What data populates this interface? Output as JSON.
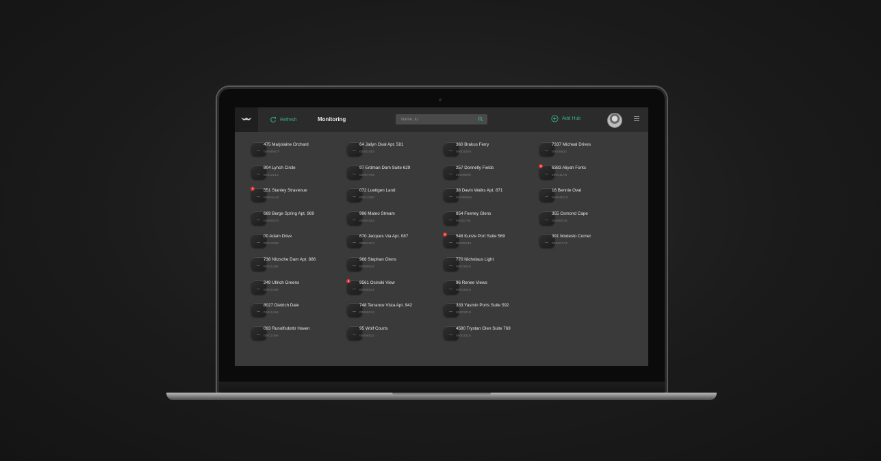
{
  "app": {
    "title": "Monitoring",
    "refresh_label": "Refresh",
    "add_hub_label": "Add Hub",
    "accent_color": "#39b08d",
    "alert_color": "#e03131"
  },
  "search": {
    "placeholder": "Name, ID"
  },
  "columns": [
    [
      {
        "name": "475 Marjolaine Orchard",
        "id": "0000B9CF",
        "alert": null
      },
      {
        "name": "804 Lynch Circle",
        "id": "00012212",
        "alert": null
      },
      {
        "name": "551 Stanley Stravenue",
        "id": "00004A42",
        "alert": "5"
      },
      {
        "name": "669 Berge Spring Apt. 969",
        "id": "00009473",
        "alert": null
      },
      {
        "name": "00 Adam Drive",
        "id": "00013339",
        "alert": null
      },
      {
        "name": "738 Nitzsche Dam Apt. 886",
        "id": "00011496",
        "alert": null
      },
      {
        "name": "249 Ullrich Greens",
        "id": "00011496",
        "alert": null
      },
      {
        "name": "8027 Dietrich Dale",
        "id": "00011496",
        "alert": null
      },
      {
        "name": "093 Runolfsdottir Haven",
        "id": "00011496",
        "alert": null
      }
    ],
    [
      {
        "name": "64 Jailyn Oval Apt. 581",
        "id": "00001083",
        "alert": null
      },
      {
        "name": "97 Erdman Dam Suite 629",
        "id": "00007006",
        "alert": null
      },
      {
        "name": "072 Luettgen Land",
        "id": "00012680",
        "alert": null
      },
      {
        "name": "996 Mateo Stream",
        "id": "00001052",
        "alert": null
      },
      {
        "name": "670 Jacques Via Apt. 087",
        "id": "000011F3",
        "alert": null
      },
      {
        "name": "968 Stephan Glens",
        "id": "00008532",
        "alert": null
      },
      {
        "name": "9561 Osinski View",
        "id": "00008532",
        "alert": "5"
      },
      {
        "name": "748 Terrance Vista Apt. 942",
        "id": "00008532",
        "alert": null
      },
      {
        "name": "95 Wolf Courts",
        "id": "00008532",
        "alert": null
      }
    ],
    [
      {
        "name": "360 Brakus Ferry",
        "id": "000010E8",
        "alert": null
      },
      {
        "name": "257 Donnelly Fields",
        "id": "00009599",
        "alert": null
      },
      {
        "name": "38 Davin Walks Apt. 871",
        "id": "0000BB59",
        "alert": null
      },
      {
        "name": "854 Feeney Glens",
        "id": "00011784",
        "alert": null
      },
      {
        "name": "548 Kunze Port Suite 569",
        "id": "0000B845",
        "alert": "5"
      },
      {
        "name": "770 Nicholaus Light",
        "id": "0000331E",
        "alert": null
      },
      {
        "name": "96 Renee Views",
        "id": "0000331E",
        "alert": null
      },
      {
        "name": "333 Yasmin Ports Suite 592",
        "id": "0000331E",
        "alert": null
      },
      {
        "name": "4580 Trystan Glen Suite 769",
        "id": "0000331E",
        "alert": null
      }
    ],
    [
      {
        "name": "7337 Micheal Drives",
        "id": "00008832",
        "alert": null
      },
      {
        "name": "6383 Aliyah Forks",
        "id": "000011A8",
        "alert": "5"
      },
      {
        "name": "16 Bennie Oval",
        "id": "00004DC6",
        "alert": null
      },
      {
        "name": "355 Osmond Cape",
        "id": "00008C08",
        "alert": null
      },
      {
        "name": "391 Modesto Corner",
        "id": "0000C7AF",
        "alert": null
      }
    ]
  ]
}
